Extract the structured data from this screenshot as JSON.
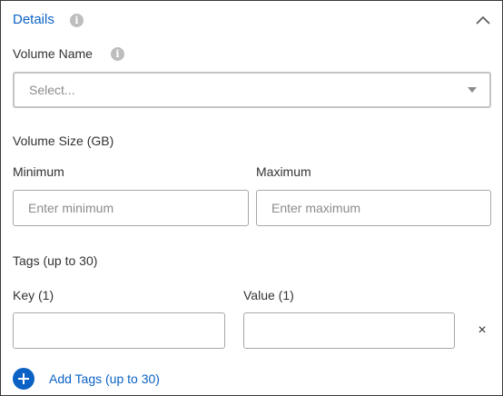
{
  "details": {
    "title": "Details",
    "info_glyph": "i"
  },
  "volume_name": {
    "label": "Volume Name",
    "placeholder": "Select..."
  },
  "volume_size": {
    "label": "Volume Size (GB)",
    "minimum_label": "Minimum",
    "minimum_placeholder": "Enter minimum",
    "maximum_label": "Maximum",
    "maximum_placeholder": "Enter maximum"
  },
  "tags": {
    "label": "Tags (up to 30)",
    "key_label": "Key (1)",
    "value_label": "Value (1)",
    "key_value": "",
    "value_value": "",
    "remove_glyph": "×",
    "add_label": "Add Tags (up to 30)"
  },
  "colors": {
    "accent": "#0b62c4",
    "border": "#a8a8a8",
    "placeholder": "#8c8c8c"
  },
  "icons": [
    "info-icon",
    "chevron-up-icon",
    "dropdown-caret-icon",
    "close-icon",
    "plus-circle-icon"
  ]
}
